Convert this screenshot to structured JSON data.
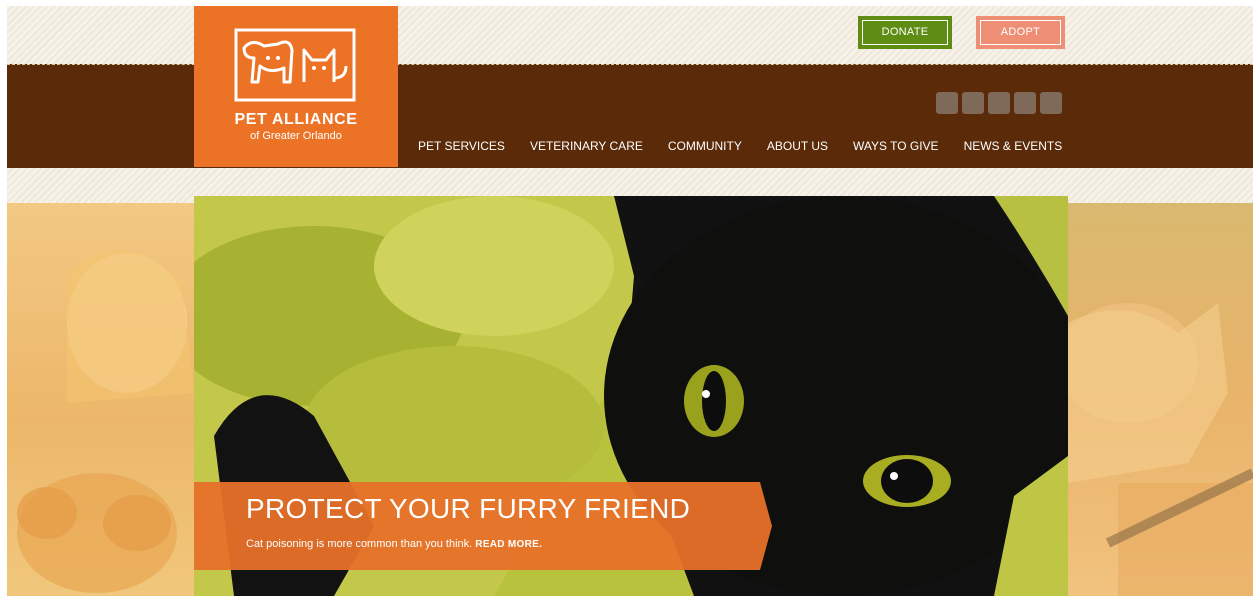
{
  "header": {
    "donate_label": "DONATE",
    "adopt_label": "ADOPT"
  },
  "logo": {
    "title": "PET ALLIANCE",
    "subtitle": "of Greater Orlando"
  },
  "nav": {
    "items": [
      {
        "label": "PET SERVICES"
      },
      {
        "label": "VETERINARY CARE"
      },
      {
        "label": "COMMUNITY"
      },
      {
        "label": "ABOUT US"
      },
      {
        "label": "WAYS TO GIVE"
      },
      {
        "label": "NEWS & EVENTS"
      }
    ]
  },
  "social": {
    "icons": [
      "social-icon-1",
      "social-icon-2",
      "social-icon-3",
      "social-icon-4",
      "social-icon-5"
    ]
  },
  "hero": {
    "title": "PROTECT YOUR FURRY FRIEND",
    "subtitle": "Cat poisoning is more common than you think.",
    "read_more": "READ MORE."
  },
  "colors": {
    "brand_orange": "#ec7226",
    "nav_brown": "#5a2a09",
    "donate_green": "#5f8d14",
    "adopt_salmon": "#ee8f75"
  }
}
